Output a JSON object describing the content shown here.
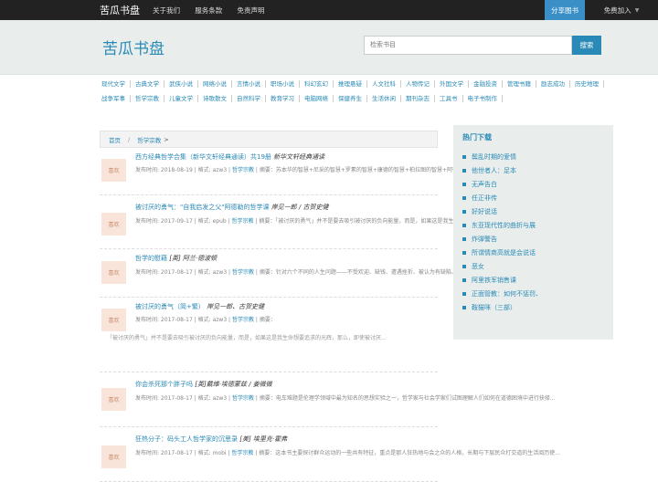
{
  "topbar": {
    "brand": "苦瓜书盘",
    "nav": [
      "关于我们",
      "服务条款",
      "免责声明"
    ],
    "share": "分享图书",
    "join": "免费加入"
  },
  "header": {
    "logo": "苦瓜书盘",
    "search_placeholder": "检索书目",
    "search_button": "搜索"
  },
  "categories": [
    "现代文学",
    "古典文学",
    "武侠小说",
    "网络小说",
    "言情小说",
    "职场小说",
    "科幻玄幻",
    "推理悬疑",
    "人文社科",
    "人物传记",
    "外国文学",
    "金融投资",
    "管理书籍",
    "励志成功",
    "历史地理",
    "战争军事",
    "哲学宗教",
    "儿童文学",
    "诗歌散文",
    "自然科学",
    "教育学习",
    "电脑网络",
    "保健养生",
    "生活休闲",
    "期刊杂志",
    "工具书",
    "电子书制作"
  ],
  "breadcrumb": {
    "home": "首页",
    "current": "哲学宗教",
    "gt": ">"
  },
  "thumb_label": "喜欢",
  "books": [
    {
      "title": "西方经典哲学合集（新华文轩经典通读）共19册",
      "author": "新华文轩经典通读",
      "date": "发布时间: 2018-08-19",
      "format": "格式: azw3",
      "category": "哲学宗教",
      "summary": "摘要：苏本华的智慧+尼采的智慧+罗素的智慧+康德的智慧+柏拉图的智慧+阿德勒的智慧+弗卡尔的智慧+弗格尔的智慧+两格..."
    },
    {
      "title": "被讨厌的勇气：\"自我启发之父\"阿德勒的哲学课",
      "author": "岸见一郎 / 古贺史健",
      "date": "发布时间: 2017-09-17",
      "format": "格式: epub",
      "category": "哲学宗教",
      "summary": "摘要：「被讨厌的勇气」并不是要去吸引被讨厌的负向能量，而是，如果这是我生命想要追求的光辉，那么，即使被别人讨厌..."
    },
    {
      "title": "哲学的慰藉",
      "author": "[英] 阿兰·德波顿",
      "date": "发布时间: 2017-08-17",
      "format": "格式: azw3",
      "category": "哲学宗教",
      "summary": "摘要：针对六个不同的人生问题——不受欢迎、缺钱、遭遇挫折、被认为有缺陷、心碎、困难——邀请哲学家给我们以慰藉..."
    },
    {
      "title": "被讨厌的勇气（简+繁）",
      "author": "岸见一郎、古贺史健",
      "date": "发布时间: 2017-08-17",
      "format": "格式: azw3",
      "category": "哲学宗教",
      "summary": "摘要：",
      "extra": "「被讨厌的勇气」并不是要去吸引被讨厌的负向能量，而是，如果这是我生命想要追求的光辉，那么，即使被讨厌..."
    },
    {
      "title": "你会杀死那个胖子吗",
      "author": "[英]戴维·埃德蒙兹 / 姜微微",
      "date": "发布时间: 2017-08-17",
      "format": "格式: azw3",
      "category": "哲学宗教",
      "summary": "摘要：电车难题是伦理学领域中最为知名的思想实验之一，哲学家与社会学家们试图理解人们如何在道德困境中进行抉择..."
    },
    {
      "title": "狂热分子：码头工人哲学家的沉思录",
      "author": "[美] 埃里克·霍弗",
      "date": "发布时间: 2017-08-17",
      "format": "格式: mobi",
      "category": "哲学宗教",
      "summary": "摘要：这本书主要探讨群众运动的一些共有特征，重点是那人狂热地与会之众的人格，长期与下层民众打交道的生活阅历使..."
    }
  ],
  "sidebar": {
    "title": "热门下载",
    "items": [
      "鬓乱时期的爱情",
      "他世者人：足本",
      "无声告白",
      "任正非传",
      "好好说话",
      "东亚现代性的曲折与展",
      "炸弹警告",
      "所谓情商高就是会说话",
      "恶女",
      "阿里铁军销售课",
      "正面管教：如何不惩罚、",
      "鞍猫咪（三部）"
    ]
  },
  "colors": {
    "accent": "#2a8ab7",
    "topbar": "#222222",
    "thumb": "#f8e4d8"
  }
}
